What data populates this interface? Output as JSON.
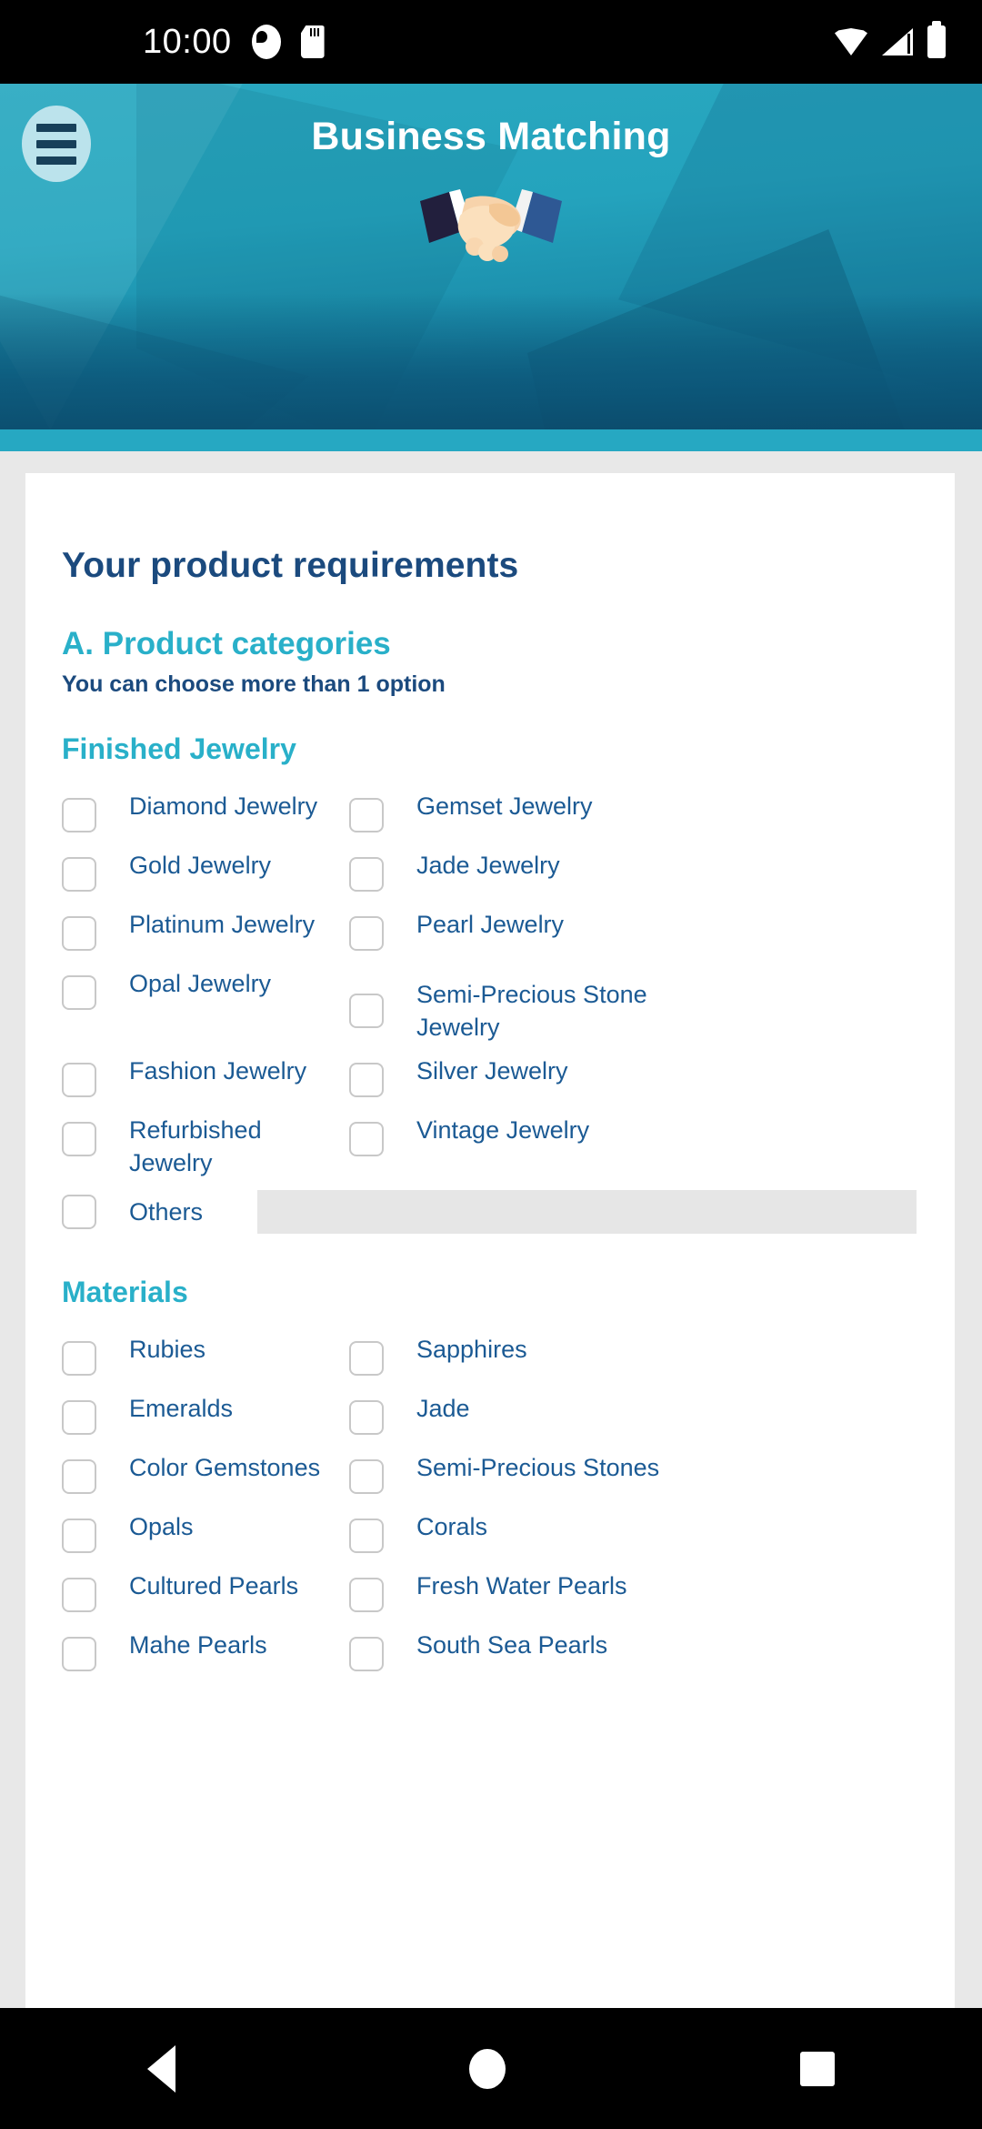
{
  "status_bar": {
    "time": "10:00",
    "left_icons": [
      "alarm-dot-icon",
      "sd-card-icon"
    ],
    "right_icons": [
      "wifi-icon",
      "signal-icon",
      "battery-icon"
    ]
  },
  "header": {
    "menu_icon": "hamburger-menu-icon",
    "title": "Business Matching",
    "illustration": "handshake-illustration",
    "bg_color": "#26a8c2",
    "accent_color": "#29b0c9"
  },
  "main": {
    "page_title": "Your product requirements",
    "section_letter": "A. Product categories",
    "section_hint": "You can choose more than 1 option",
    "groups": [
      {
        "title": "Finished Jewelry",
        "options": [
          "Diamond Jewelry",
          "Gemset Jewelry",
          "Gold Jewelry",
          "Jade Jewelry",
          "Platinum Jewelry",
          "Pearl Jewelry",
          "Opal Jewelry",
          "Semi-Precious Stone Jewelry",
          "Fashion Jewelry",
          "Silver Jewelry",
          "Refurbished Jewelry",
          "Vintage Jewelry"
        ],
        "others_label": "Others",
        "others_value": "",
        "others_placeholder": ""
      },
      {
        "title": "Materials",
        "options": [
          "Rubies",
          "Sapphires",
          "Emeralds",
          "Jade",
          "Color Gemstones",
          "Semi-Precious Stones",
          "Opals",
          "Corals",
          "Cultured Pearls",
          "Fresh Water Pearls",
          "Mahe Pearls",
          "South Sea Pearls"
        ]
      }
    ]
  },
  "nav_bar": {
    "back_label": "Back",
    "home_label": "Home",
    "recent_label": "Recent apps"
  },
  "colors": {
    "title_navy": "#1b4a7e",
    "label_blue": "#1b5a94",
    "teal": "#29b0c9",
    "page_bg": "#e8e8e8",
    "card_bg": "#ffffff",
    "disabled_input": "#e6e6e6"
  }
}
